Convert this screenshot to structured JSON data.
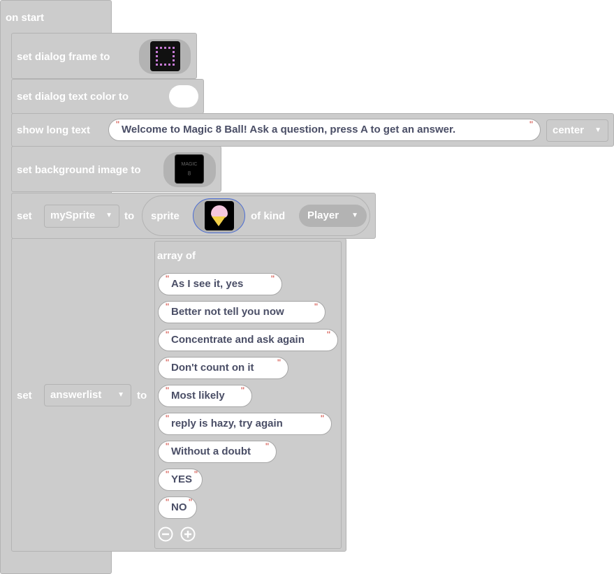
{
  "on_start": {
    "label": "on start"
  },
  "dialog_frame": {
    "label": "set dialog frame to",
    "image_icon": "dialog-frame-image"
  },
  "dialog_text_color": {
    "label": "set dialog text color to",
    "color": "#ffffff"
  },
  "show_long_text": {
    "label": "show long text",
    "text": "Welcome to Magic 8 Ball! Ask a question, press A to get an answer.",
    "position": "center"
  },
  "background": {
    "label": "set background image to",
    "image_text_1": "MAGIC",
    "image_text_2": "8"
  },
  "set_sprite": {
    "set_label": "set",
    "variable": "mySprite",
    "to_label": "to",
    "sprite_label": "sprite",
    "sprite_icon": "ice-cream-sprite",
    "kind_label": "of kind",
    "kind": "Player"
  },
  "set_answers": {
    "set_label": "set",
    "variable": "answerlist",
    "to_label": "to",
    "array_label": "array of",
    "items": [
      "As I see it, yes",
      "Better not tell you now",
      "Concentrate and ask again",
      "Don't count on it",
      "Most likely",
      "reply is hazy, try again",
      "Without a doubt",
      "YES",
      "NO"
    ]
  },
  "colors": {
    "block": "#cccccc",
    "block_border": "#b3b3b3",
    "string_text": "#4a4e66",
    "quote": "#d0453c"
  }
}
